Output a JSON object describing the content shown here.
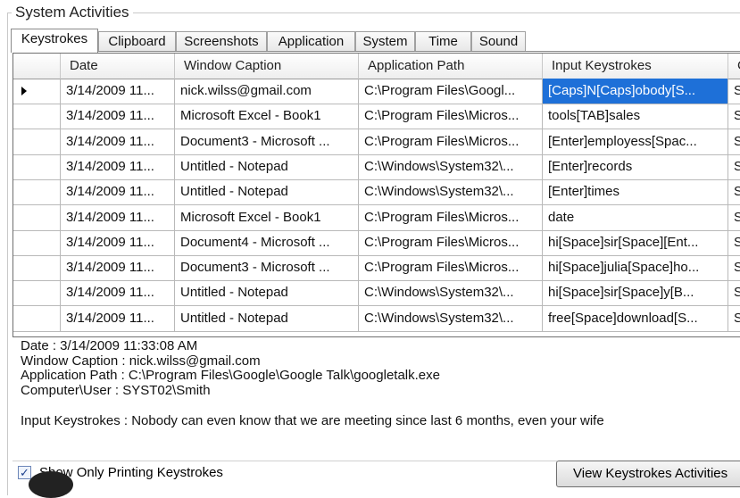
{
  "group_title": "System Activities",
  "tabs": [
    {
      "label": "Keystrokes",
      "active": true
    },
    {
      "label": "Clipboard"
    },
    {
      "label": "Screenshots"
    },
    {
      "label": "Application"
    },
    {
      "label": "System"
    },
    {
      "label": "Time"
    },
    {
      "label": "Sound"
    }
  ],
  "grid": {
    "columns": [
      "Date",
      "Window Caption",
      "Application Path",
      "Input Keystrokes",
      "C"
    ],
    "rows": [
      [
        "3/14/2009 11...",
        "nick.wilss@gmail.com",
        "C:\\Program Files\\Googl...",
        "[Caps]N[Caps]obody[S...",
        "S"
      ],
      [
        "3/14/2009 11...",
        "Microsoft Excel - Book1",
        "C:\\Program Files\\Micros...",
        "tools[TAB]sales",
        "S"
      ],
      [
        "3/14/2009 11...",
        "Document3 - Microsoft ...",
        "C:\\Program Files\\Micros...",
        "[Enter]employess[Spac...",
        "S"
      ],
      [
        "3/14/2009 11...",
        "Untitled - Notepad",
        "C:\\Windows\\System32\\...",
        "[Enter]records",
        "S"
      ],
      [
        "3/14/2009 11...",
        "Untitled - Notepad",
        "C:\\Windows\\System32\\...",
        "[Enter]times",
        "S"
      ],
      [
        "3/14/2009 11...",
        "Microsoft Excel - Book1",
        "C:\\Program Files\\Micros...",
        "date",
        "S"
      ],
      [
        "3/14/2009 11...",
        "Document4 - Microsoft ...",
        "C:\\Program Files\\Micros...",
        "hi[Space]sir[Space][Ent...",
        "S"
      ],
      [
        "3/14/2009 11...",
        "Document3 - Microsoft ...",
        "C:\\Program Files\\Micros...",
        "hi[Space]julia[Space]ho...",
        "S"
      ],
      [
        "3/14/2009 11...",
        "Untitled - Notepad",
        "C:\\Windows\\System32\\...",
        "hi[Space]sir[Space]y[B...",
        "S"
      ],
      [
        "3/14/2009 11...",
        "Untitled - Notepad",
        "C:\\Windows\\System32\\...",
        "free[Space]download[S...",
        "S"
      ]
    ],
    "selected_row": 0,
    "selected_cell": 3
  },
  "details": {
    "date": "Date : 3/14/2009 11:33:08 AM",
    "window_caption": "Window Caption : nick.wilss@gmail.com",
    "application_path": "Application Path : C:\\Program Files\\Google\\Google Talk\\googletalk.exe",
    "computer_user": "Computer\\User : SYST02\\Smith",
    "input_keystrokes": "Input Keystrokes : Nobody can even know that we are meeting since last 6 months, even your wife"
  },
  "footer": {
    "checkbox_label": "Show Only Printing Keystrokes",
    "checkbox_checked": "✓",
    "view_button_label": "View Keystrokes Activities"
  }
}
